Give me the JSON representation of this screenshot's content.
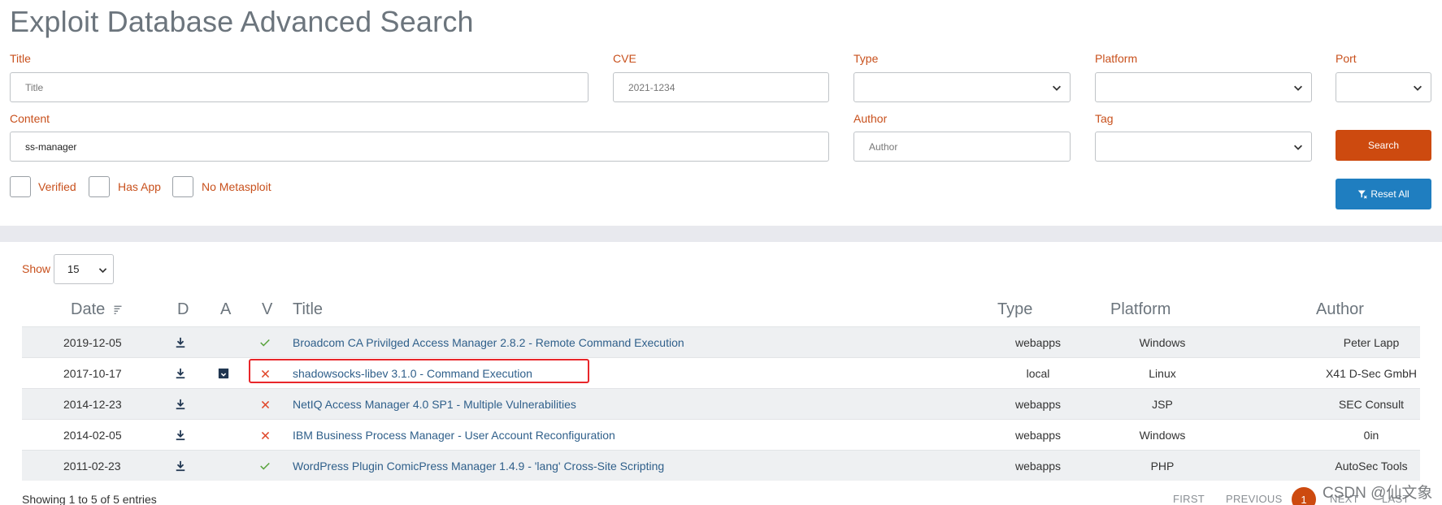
{
  "page_title": "Exploit Database Advanced Search",
  "form": {
    "title": {
      "label": "Title",
      "placeholder": "Title",
      "value": ""
    },
    "cve": {
      "label": "CVE",
      "placeholder": "2021-1234",
      "value": ""
    },
    "type": {
      "label": "Type",
      "value": ""
    },
    "platform": {
      "label": "Platform",
      "value": ""
    },
    "port": {
      "label": "Port",
      "value": ""
    },
    "content": {
      "label": "Content",
      "placeholder": "",
      "value": "ss-manager"
    },
    "author": {
      "label": "Author",
      "placeholder": "Author",
      "value": ""
    },
    "tag": {
      "label": "Tag",
      "value": ""
    },
    "checkboxes": {
      "verified": "Verified",
      "has_app": "Has App",
      "no_metasploit": "No Metasploit"
    },
    "search_button": "Search",
    "reset_button": "Reset All"
  },
  "results": {
    "show_label": "Show",
    "show_value": "15",
    "columns": {
      "date": "Date",
      "d": "D",
      "a": "A",
      "v": "V",
      "title": "Title",
      "type": "Type",
      "platform": "Platform",
      "author": "Author"
    },
    "rows": [
      {
        "date": "2019-12-05",
        "has_app": false,
        "verified": true,
        "title": "Broadcom CA Privilged Access Manager 2.8.2 - Remote Command Execution",
        "type": "webapps",
        "platform": "Windows",
        "author": "Peter Lapp"
      },
      {
        "date": "2017-10-17",
        "has_app": true,
        "verified": false,
        "title": "shadowsocks-libev 3.1.0 - Command Execution",
        "type": "local",
        "platform": "Linux",
        "author": "X41 D-Sec GmbH"
      },
      {
        "date": "2014-12-23",
        "has_app": false,
        "verified": false,
        "title": "NetIQ Access Manager 4.0 SP1 - Multiple Vulnerabilities",
        "type": "webapps",
        "platform": "JSP",
        "author": "SEC Consult"
      },
      {
        "date": "2014-02-05",
        "has_app": false,
        "verified": false,
        "title": "IBM Business Process Manager - User Account Reconfiguration",
        "type": "webapps",
        "platform": "Windows",
        "author": "0in"
      },
      {
        "date": "2011-02-23",
        "has_app": false,
        "verified": true,
        "title": "WordPress Plugin ComicPress Manager 1.4.9 - 'lang' Cross-Site Scripting",
        "type": "webapps",
        "platform": "PHP",
        "author": "AutoSec Tools"
      }
    ],
    "info": "Showing 1 to 5 of 5 entries",
    "pagination": {
      "first": "FIRST",
      "previous": "PREVIOUS",
      "current": "1",
      "next": "NEXT",
      "last": "LAST"
    }
  },
  "watermark": "CSDN @仙文象",
  "colors": {
    "accent": "#cd4a0f",
    "reset": "#1f7ec0",
    "link": "#2f5f8a",
    "verified": "#5aa33e",
    "unverified": "#e0472a",
    "highlight": "#e8262a"
  }
}
